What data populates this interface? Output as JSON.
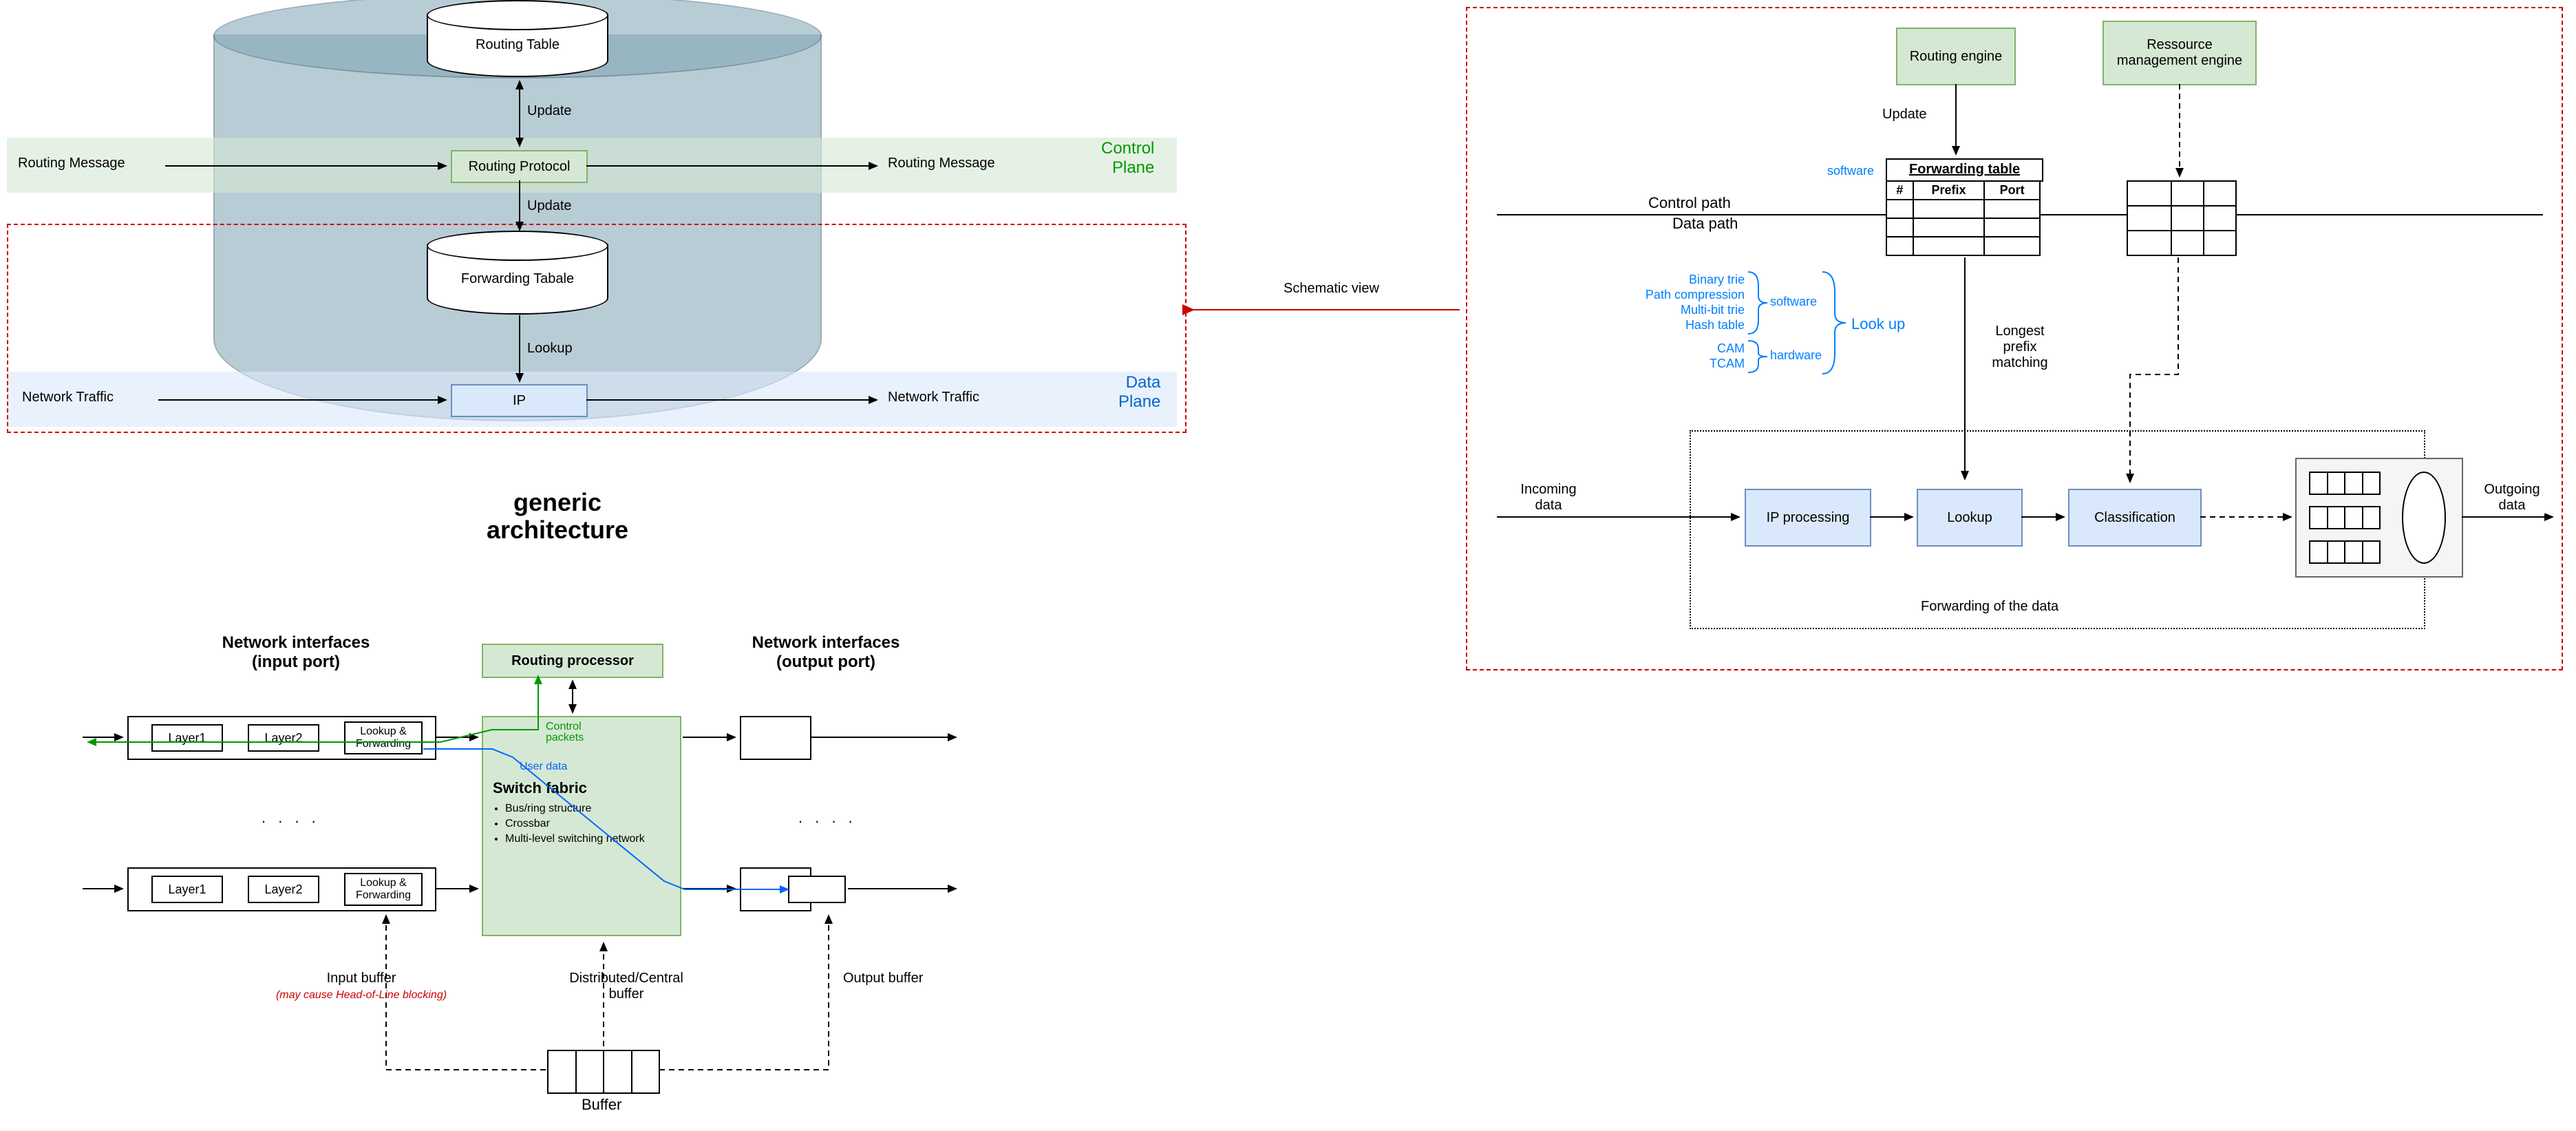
{
  "topLeft": {
    "routingTable": "Routing Table",
    "routingProtocol": "Routing Protocol",
    "forwardingTable": "Forwarding Tabale",
    "ip": "IP",
    "update": "Update",
    "lookup": "Lookup",
    "routingMessageL": "Routing Message",
    "routingMessageR": "Routing Message",
    "networkTrafficL": "Network Traffic",
    "networkTrafficR": "Network Traffic",
    "controlPlane1": "Control",
    "controlPlane2": "Plane",
    "dataPlane1": "Data",
    "dataPlane2": "Plane"
  },
  "middleArrow": {
    "schematicView": "Schematic view"
  },
  "right": {
    "routingEngine": "Routing engine",
    "resourceEngine": "Ressource management engine",
    "update": "Update",
    "forwardingTable": "Forwarding table",
    "col1": "#",
    "col2": "Prefix",
    "col3": "Port",
    "software": "software",
    "controlPath": "Control path",
    "dataPath": "Data path",
    "lookupLabel": "Look up",
    "swList1": "Binary trie",
    "swList2": "Path compression",
    "swList3": "Multi-bit trie",
    "swList4": "Hash table",
    "hwList1": "CAM",
    "hwList2": "TCAM",
    "swBrace": "software",
    "hwBrace": "hardware",
    "longestPrefix": "Longest prefix matching",
    "incomingData": "Incoming data",
    "outgoingData": "Outgoing data",
    "ipProcessing": "IP processing",
    "lookup": "Lookup",
    "classification": "Classification",
    "forwardingCaption": "Forwarding of the data"
  },
  "bottom": {
    "title1": "generic",
    "title2": "architecture",
    "inputHeader1": "Network interfaces",
    "inputHeader2": "(input port)",
    "outputHeader1": "Network interfaces",
    "outputHeader2": "(output port)",
    "routingProcessor": "Routing processor",
    "layer1": "Layer1",
    "layer2": "Layer2",
    "lookupFwd": "Lookup & Forwarding",
    "switchFabric": "Switch fabric",
    "sf1": "Bus/ring structure",
    "sf2": "Crossbar",
    "sf3": "Multi-level switching network",
    "controlPackets": "Control packets",
    "userData": "User data",
    "dots": ". . . .",
    "inputBuffer": "Input buffer",
    "hol": "(may cause Head-of-Line blocking)",
    "distBuffer": "Distributed/Central buffer",
    "outputBuffer": "Output buffer",
    "buffer": "Buffer"
  }
}
